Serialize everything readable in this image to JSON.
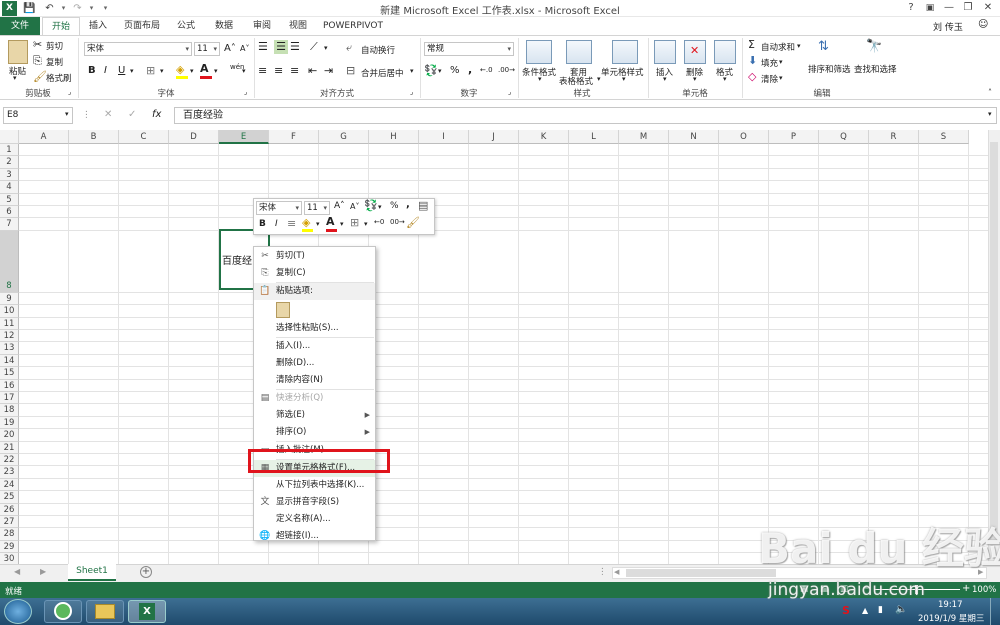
{
  "window": {
    "title": "新建 Microsoft Excel 工作表.xlsx - Microsoft Excel",
    "user": "刘 传玉",
    "help": "?",
    "minimize": "—",
    "restore": "❐",
    "close": "✕"
  },
  "tabs": [
    "文件",
    "开始",
    "插入",
    "页面布局",
    "公式",
    "数据",
    "审阅",
    "视图",
    "POWERPIVOT"
  ],
  "ribbon": {
    "clipboard": {
      "paste": "粘贴",
      "cut": "剪切",
      "copy": "复制",
      "format_painter": "格式刷",
      "label": "剪贴板"
    },
    "font": {
      "name": "宋体",
      "size": "11",
      "grow": "A˄",
      "shrink": "A˅",
      "bold": "B",
      "italic": "I",
      "underline": "U",
      "label": "字体",
      "phonetic": "wén"
    },
    "alignment": {
      "wrap": "自动换行",
      "merge": "合并后居中",
      "label": "对齐方式"
    },
    "number": {
      "format": "常规",
      "percent": "%",
      "comma": ",",
      "label": "数字"
    },
    "styles": {
      "conditional": "条件格式",
      "table1": "套用",
      "table2": "表格格式",
      "cell_styles": "单元格样式",
      "label": "样式"
    },
    "cells": {
      "insert": "插入",
      "delete": "删除",
      "format": "格式",
      "label": "单元格"
    },
    "editing": {
      "autosum": "自动求和",
      "fill": "填充",
      "clear": "清除",
      "sort": "排序和筛选",
      "find": "查找和选择",
      "label": "编辑"
    }
  },
  "formula_bar": {
    "name_box": "E8",
    "fx": "fx",
    "cancel": "✕",
    "confirm": "✓",
    "value": "百度经验"
  },
  "columns": [
    "A",
    "B",
    "C",
    "D",
    "E",
    "F",
    "G",
    "H",
    "I",
    "J",
    "K",
    "L",
    "M",
    "N",
    "O",
    "P",
    "Q",
    "R",
    "S"
  ],
  "rows": [
    "1",
    "2",
    "3",
    "4",
    "5",
    "6",
    "7",
    "8",
    "9",
    "10",
    "11",
    "12",
    "13",
    "14",
    "15",
    "16",
    "17",
    "18",
    "19",
    "20",
    "21",
    "22",
    "23",
    "24",
    "25",
    "26",
    "27",
    "28",
    "29",
    "30"
  ],
  "cell_value": "百度经",
  "mini_toolbar": {
    "font": "宋体",
    "size": "11",
    "grow": "A˄",
    "shrink": "A˅",
    "percent": "%",
    "comma": ",",
    "bold": "B",
    "italic": "I"
  },
  "context_menu": [
    {
      "label": "剪切(T)",
      "icon": "✂",
      "disabled": false
    },
    {
      "label": "复制(C)",
      "icon": "⎘",
      "disabled": false
    },
    {
      "label": "粘贴选项:",
      "icon": "📋",
      "disabled": false,
      "header": true
    },
    {
      "label": "",
      "icon": "",
      "disabled": false,
      "paste_icon": true
    },
    {
      "label": "选择性粘贴(S)...",
      "icon": "",
      "disabled": false
    },
    {
      "label": "插入(I)...",
      "icon": "",
      "disabled": false
    },
    {
      "label": "删除(D)...",
      "icon": "",
      "disabled": false
    },
    {
      "label": "清除内容(N)",
      "icon": "",
      "disabled": false
    },
    {
      "label": "快速分析(Q)",
      "icon": "▤",
      "disabled": true
    },
    {
      "label": "筛选(E)",
      "icon": "",
      "disabled": false,
      "submenu": true
    },
    {
      "label": "排序(O)",
      "icon": "",
      "disabled": false,
      "submenu": true
    },
    {
      "label": "插入批注(M)",
      "icon": "▭",
      "disabled": false
    },
    {
      "label": "设置单元格格式(F)...",
      "icon": "▦",
      "disabled": false,
      "highlight": true
    },
    {
      "label": "从下拉列表中选择(K)...",
      "icon": "",
      "disabled": false
    },
    {
      "label": "显示拼音字段(S)",
      "icon": "文",
      "disabled": false
    },
    {
      "label": "定义名称(A)...",
      "icon": "",
      "disabled": false
    },
    {
      "label": "超链接(I)...",
      "icon": "🌐",
      "disabled": false
    }
  ],
  "sheet_tab": "Sheet1",
  "add_sheet": "+",
  "status": {
    "ready": "就绪",
    "zoom": "100%",
    "minus": "−",
    "plus": "+"
  },
  "taskbar": {
    "time": "19:17",
    "date": "2019/1/9 星期三"
  },
  "watermark": {
    "main": "Bai du 经验",
    "url": "jingyan.baidu.com"
  }
}
